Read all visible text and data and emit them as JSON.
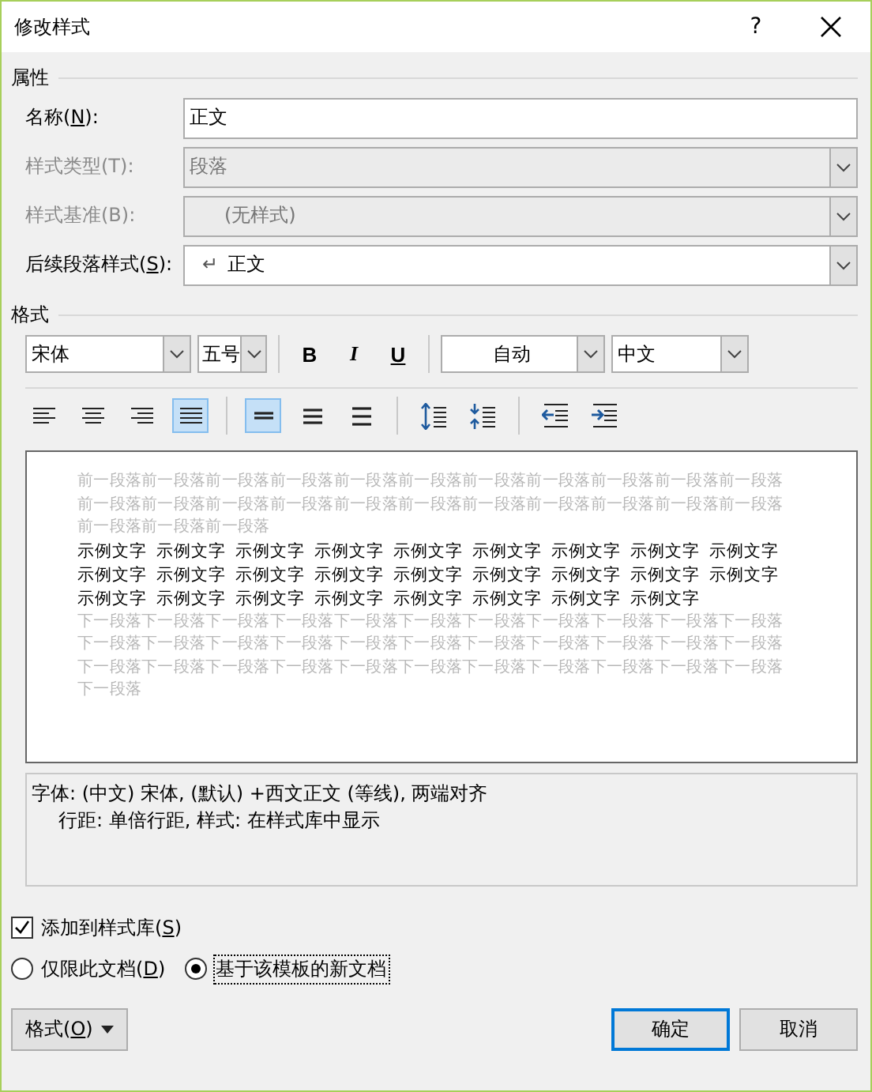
{
  "window": {
    "title": "修改样式",
    "help": "?"
  },
  "properties": {
    "heading": "属性",
    "fields": [
      {
        "kind": "text",
        "pre": "名称(",
        "key": "N",
        "post": "):",
        "value": "正文",
        "disabled": false
      },
      {
        "kind": "select",
        "pre": "样式类型(T):",
        "value": "段落",
        "disabled": true
      },
      {
        "kind": "select",
        "pre": "样式基准(B):",
        "value": "(无样式)",
        "disabled": true,
        "indented": true
      },
      {
        "kind": "select",
        "pre": "后续段落样式(",
        "key": "S",
        "post": "):",
        "marker": "↵",
        "value": "正文",
        "disabled": false
      }
    ]
  },
  "format": {
    "heading": "格式",
    "font": "宋体",
    "size": "五号",
    "styles": [
      {
        "kind": "bold",
        "label": "B",
        "selected": false
      },
      {
        "kind": "italic",
        "label": "I",
        "selected": false
      },
      {
        "kind": "underline",
        "label": "U",
        "selected": false
      }
    ],
    "color_setting": "自动",
    "language": "中文",
    "paragraph_buttons": [
      [
        {
          "kind": "align-left",
          "selected": false
        },
        {
          "kind": "align-center",
          "selected": false
        },
        {
          "kind": "align-right",
          "selected": false
        },
        {
          "kind": "justify",
          "selected": true
        }
      ],
      [
        {
          "kind": "spacing-single",
          "selected": true
        },
        {
          "kind": "spacing-medium",
          "selected": false
        },
        {
          "kind": "spacing-double",
          "selected": false
        }
      ],
      [
        {
          "kind": "space-increase",
          "selected": false
        },
        {
          "kind": "space-decrease",
          "selected": false
        }
      ],
      [
        {
          "kind": "indent-decrease",
          "selected": false
        },
        {
          "kind": "indent-increase",
          "selected": false
        }
      ]
    ]
  },
  "preview": {
    "previous": "前一段落前一段落前一段落前一段落前一段落前一段落前一段落前一段落前一段落前一段落前一段落前一段落前一段落前一段落前一段落前一段落前一段落前一段落前一段落前一段落前一段落前一段落前一段落前一段落前一段落",
    "sample": [
      "示例文字",
      "示例文字",
      "示例文字",
      "示例文字",
      "示例文字",
      "示例文字",
      "示例文字",
      "示例文字",
      "示例文字",
      "示例文字",
      "示例文字",
      "示例文字",
      "示例文字",
      "示例文字",
      "示例文字",
      "示例文字",
      "示例文字",
      "示例文字",
      "示例文字",
      "示例文字",
      "示例文字",
      "示例文字",
      "示例文字",
      "示例文字",
      "示例文字",
      "示例文字"
    ],
    "next": "下一段落下一段落下一段落下一段落下一段落下一段落下一段落下一段落下一段落下一段落下一段落下一段落下一段落下一段落下一段落下一段落下一段落下一段落下一段落下一段落下一段落下一段落下一段落下一段落下一段落下一段落下一段落下一段落下一段落下一段落下一段落下一段落下一段落下一段落"
  },
  "description": [
    "字体: (中文) 宋体, (默认) +西文正文 (等线), 两端对齐",
    "行距: 单倍行距, 样式: 在样式库中显示"
  ],
  "add_to_gallery": {
    "pre": "添加到样式库(",
    "key": "S",
    "post": ")",
    "checked": true
  },
  "scope": [
    {
      "pre": "仅限此文档(",
      "key": "D",
      "post": ")",
      "selected": false
    },
    {
      "pre": "基于该模板的新文档",
      "selected": true
    }
  ],
  "format_button": {
    "pre": "格式(",
    "key": "O",
    "post": ")"
  },
  "buttons": [
    {
      "label": "确定",
      "default": true
    },
    {
      "label": "取消",
      "default": false
    }
  ]
}
